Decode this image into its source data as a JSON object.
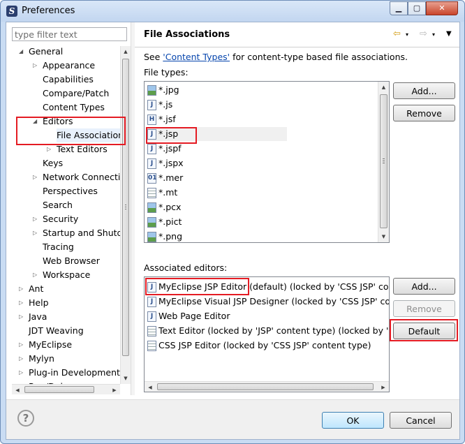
{
  "window": {
    "title": "Preferences",
    "app_icon": "S",
    "minimize_glyph": "▁",
    "maximize_glyph": "▢",
    "close_glyph": "✕"
  },
  "filter": {
    "placeholder": "type filter text"
  },
  "tree": [
    {
      "label": "General",
      "arrow": "◢"
    },
    {
      "label": "Appearance",
      "arrow": "▷"
    },
    {
      "label": "Capabilities",
      "arrow": ""
    },
    {
      "label": "Compare/Patch",
      "arrow": ""
    },
    {
      "label": "Content Types",
      "arrow": ""
    },
    {
      "label": "Editors",
      "arrow": "◢"
    },
    {
      "label": "File Associations",
      "arrow": ""
    },
    {
      "label": "Text Editors",
      "arrow": "▷"
    },
    {
      "label": "Keys",
      "arrow": ""
    },
    {
      "label": "Network Connections",
      "arrow": "▷"
    },
    {
      "label": "Perspectives",
      "arrow": ""
    },
    {
      "label": "Search",
      "arrow": ""
    },
    {
      "label": "Security",
      "arrow": "▷"
    },
    {
      "label": "Startup and Shutdown",
      "arrow": "▷"
    },
    {
      "label": "Tracing",
      "arrow": ""
    },
    {
      "label": "Web Browser",
      "arrow": ""
    },
    {
      "label": "Workspace",
      "arrow": "▷"
    },
    {
      "label": "Ant",
      "arrow": "▷"
    },
    {
      "label": "Help",
      "arrow": "▷"
    },
    {
      "label": "Java",
      "arrow": "▷"
    },
    {
      "label": "JDT Weaving",
      "arrow": ""
    },
    {
      "label": "MyEclipse",
      "arrow": "▷"
    },
    {
      "label": "Mylyn",
      "arrow": "▷"
    },
    {
      "label": "Plug-in Development",
      "arrow": "▷"
    },
    {
      "label": "Run/Debug",
      "arrow": "▷"
    }
  ],
  "page": {
    "title": "File Associations",
    "back_glyph": "⇦",
    "forward_glyph": "⇨",
    "menu_glyph": "▾",
    "see_prefix": "See ",
    "see_link": "'Content Types'",
    "see_suffix": " for content-type based file associations.",
    "file_types_label": "File types:",
    "associated_editors_label": "Associated editors:"
  },
  "file_types": [
    {
      "name": "*.jpg",
      "icon": "image-file",
      "glyph": ""
    },
    {
      "name": "*.js",
      "icon": "js-file",
      "glyph": "J"
    },
    {
      "name": "*.jsf",
      "icon": "jsf-file",
      "glyph": "H"
    },
    {
      "name": "*.jsp",
      "icon": "jsp-file",
      "glyph": "J"
    },
    {
      "name": "*.jspf",
      "icon": "jsp-file",
      "glyph": "J"
    },
    {
      "name": "*.jspx",
      "icon": "jsp-file",
      "glyph": "J"
    },
    {
      "name": "*.mer",
      "icon": "mer-file",
      "glyph": "01"
    },
    {
      "name": "*.mt",
      "icon": "text-file",
      "glyph": ""
    },
    {
      "name": "*.pcx",
      "icon": "image-file",
      "glyph": ""
    },
    {
      "name": "*.pict",
      "icon": "image-file",
      "glyph": ""
    },
    {
      "name": "*.png",
      "icon": "image-file",
      "glyph": ""
    }
  ],
  "editors": [
    {
      "name": "MyEclipse JSP Editor",
      "detail": " (default) (locked by 'CSS JSP' content type)",
      "icon": "jsp-editor",
      "glyph": "J"
    },
    {
      "name": "MyEclipse Visual JSP Designer",
      "detail": " (locked by 'CSS JSP' content type)",
      "icon": "jsp-editor",
      "glyph": "J"
    },
    {
      "name": "Web Page Editor",
      "detail": "",
      "icon": "web-page-editor",
      "glyph": "J"
    },
    {
      "name": "Text Editor",
      "detail": " (locked by 'JSP' content type) (locked by 'CSS JSP' content type)",
      "icon": "text-editor",
      "glyph": ""
    },
    {
      "name": "CSS JSP Editor",
      "detail": " (locked by 'CSS JSP' content type)",
      "icon": "text-editor",
      "glyph": ""
    }
  ],
  "buttons": {
    "add_types": "Add...",
    "remove_types": "Remove",
    "add_editors": "Add...",
    "remove_editors": "Remove",
    "default": "Default",
    "ok": "OK",
    "cancel": "Cancel",
    "help": "?"
  },
  "colors": {
    "highlight": "#e41b23",
    "selection": "#e8f1fc",
    "link": "#0645ad"
  }
}
